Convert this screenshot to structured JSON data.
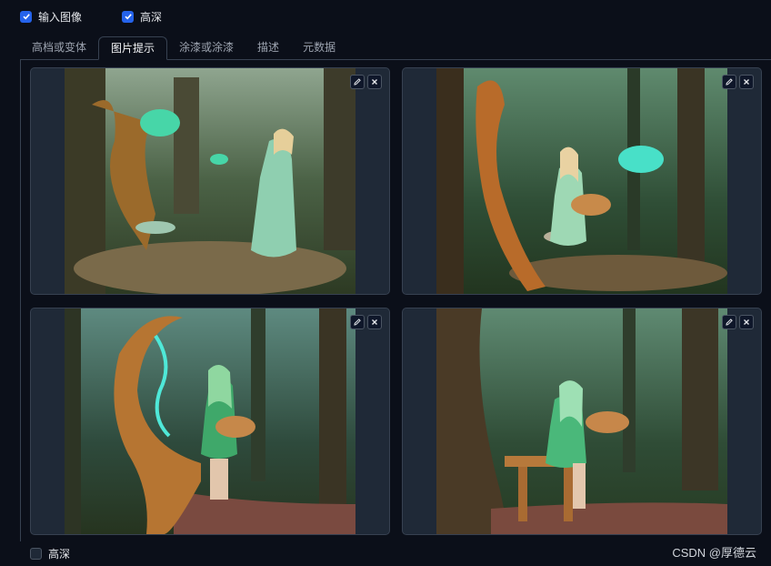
{
  "top_options": {
    "input_image_label": "输入图像",
    "input_image_checked": true,
    "high_depth_label": "高深",
    "high_depth_checked": true
  },
  "tabs": [
    {
      "label": "高档或变体",
      "active": false
    },
    {
      "label": "图片提示",
      "active": true
    },
    {
      "label": "涂漆或涂漆",
      "active": false
    },
    {
      "label": "描述",
      "active": false
    },
    {
      "label": "元数据",
      "active": false
    }
  ],
  "gallery": {
    "images": [
      {
        "icon_edit": "pencil-icon",
        "icon_close": "close-icon"
      },
      {
        "icon_edit": "pencil-icon",
        "icon_close": "close-icon"
      },
      {
        "icon_edit": "pencil-icon",
        "icon_close": "close-icon"
      },
      {
        "icon_edit": "pencil-icon",
        "icon_close": "close-icon"
      }
    ]
  },
  "bottom_option": {
    "label": "高深",
    "checked": false
  },
  "watermark": "CSDN @厚德云",
  "colors": {
    "accent": "#2563eb",
    "background": "#0b0f19",
    "panel": "#1f2937"
  }
}
